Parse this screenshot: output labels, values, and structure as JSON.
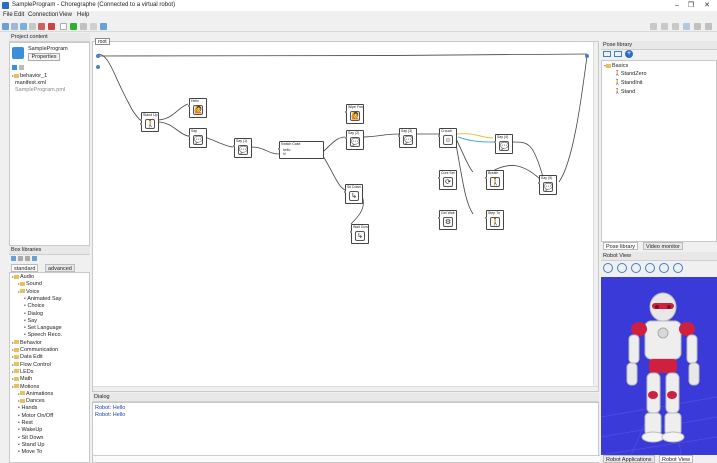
{
  "window": {
    "title": "SampleProgram - Choregraphe (Connected to a virtual robot)"
  },
  "menu": [
    "File",
    "Edit",
    "Connection",
    "View",
    "Help"
  ],
  "project_content": {
    "header": "Project content",
    "name": "SampleProgram",
    "properties_label": "Properties",
    "files": [
      "behavior_1",
      "manifest.xml",
      "SampleProgram.pml"
    ]
  },
  "box_libraries": {
    "header": "Box libraries",
    "tabs": [
      "standard",
      "advanced"
    ],
    "items": [
      {
        "label": "Audio",
        "level": 0,
        "kind": "folder"
      },
      {
        "label": "Sound",
        "level": 1,
        "kind": "folder"
      },
      {
        "label": "Voice",
        "level": 1,
        "kind": "folder"
      },
      {
        "label": "Animated Say",
        "level": 2,
        "kind": "box"
      },
      {
        "label": "Choice",
        "level": 2,
        "kind": "box"
      },
      {
        "label": "Dialog",
        "level": 2,
        "kind": "box"
      },
      {
        "label": "Say",
        "level": 2,
        "kind": "box"
      },
      {
        "label": "Set Language",
        "level": 2,
        "kind": "box"
      },
      {
        "label": "Speech Reco.",
        "level": 2,
        "kind": "box"
      },
      {
        "label": "Behavior",
        "level": 0,
        "kind": "folder"
      },
      {
        "label": "Communication",
        "level": 0,
        "kind": "folder"
      },
      {
        "label": "Data Edit",
        "level": 0,
        "kind": "folder"
      },
      {
        "label": "Flow Control",
        "level": 0,
        "kind": "folder"
      },
      {
        "label": "LEDs",
        "level": 0,
        "kind": "folder"
      },
      {
        "label": "Math",
        "level": 0,
        "kind": "folder"
      },
      {
        "label": "Motions",
        "level": 0,
        "kind": "folder"
      },
      {
        "label": "Animations",
        "level": 1,
        "kind": "folder"
      },
      {
        "label": "Dances",
        "level": 1,
        "kind": "folder"
      },
      {
        "label": "Hands",
        "level": 1,
        "kind": "box"
      },
      {
        "label": "Motor On/Off",
        "level": 1,
        "kind": "box"
      },
      {
        "label": "Rest",
        "level": 1,
        "kind": "box"
      },
      {
        "label": "WakeUp",
        "level": 1,
        "kind": "box"
      },
      {
        "label": "Sit Down",
        "level": 1,
        "kind": "box"
      },
      {
        "label": "Stand Up",
        "level": 1,
        "kind": "box"
      },
      {
        "label": "Move To",
        "level": 1,
        "kind": "box"
      }
    ]
  },
  "editor": {
    "breadcrumb": "root",
    "boxes": [
      {
        "title": "Stand Up",
        "icon": "🚶"
      },
      {
        "title": "Hello",
        "icon": "🙋"
      },
      {
        "title": "Say",
        "icon": "💬"
      },
      {
        "title": "Say (1)",
        "icon": "💬"
      },
      {
        "title": "Switch Case",
        "icon": "≡"
      },
      {
        "title": "Wipe Fore",
        "icon": "🙋"
      },
      {
        "title": "Say (2)",
        "icon": "💬"
      },
      {
        "title": "Say (3)",
        "icon": "💬"
      },
      {
        "title": "Sit Down",
        "icon": "↳"
      },
      {
        "title": "Wait Down",
        "icon": "↳"
      },
      {
        "title": "Crouch",
        "icon": "☺"
      },
      {
        "title": "Say (4)",
        "icon": "💬"
      },
      {
        "title": "Curs Set",
        "icon": "⟳"
      },
      {
        "title": "Breath",
        "icon": "🚶"
      },
      {
        "title": "Say (5)",
        "icon": "💬"
      },
      {
        "title": "Get Wait",
        "icon": "⚙"
      },
      {
        "title": "Step To",
        "icon": "🚶"
      }
    ],
    "switch_case_values": [
      "hello",
      "hi"
    ]
  },
  "dialog": {
    "header": "Dialog",
    "lines": [
      "Robot: Hello",
      "Robot: Hello"
    ]
  },
  "pose_library": {
    "header": "Pose library",
    "folder": "Basics",
    "poses": [
      "StandZero",
      "StandInit",
      "Stand"
    ],
    "tabs": [
      "Pose library",
      "Video monitor"
    ]
  },
  "robot_view": {
    "header": "Robot View",
    "tabs": [
      "Robot Applications",
      "Robot View"
    ]
  },
  "colors": {
    "connection_cyan": "#4aa8d8",
    "connection_yellow": "#e8c040",
    "folder_yellow": "#e8c060",
    "robot_bg": "#3a3ad8",
    "accent": "#2b6cc4"
  }
}
